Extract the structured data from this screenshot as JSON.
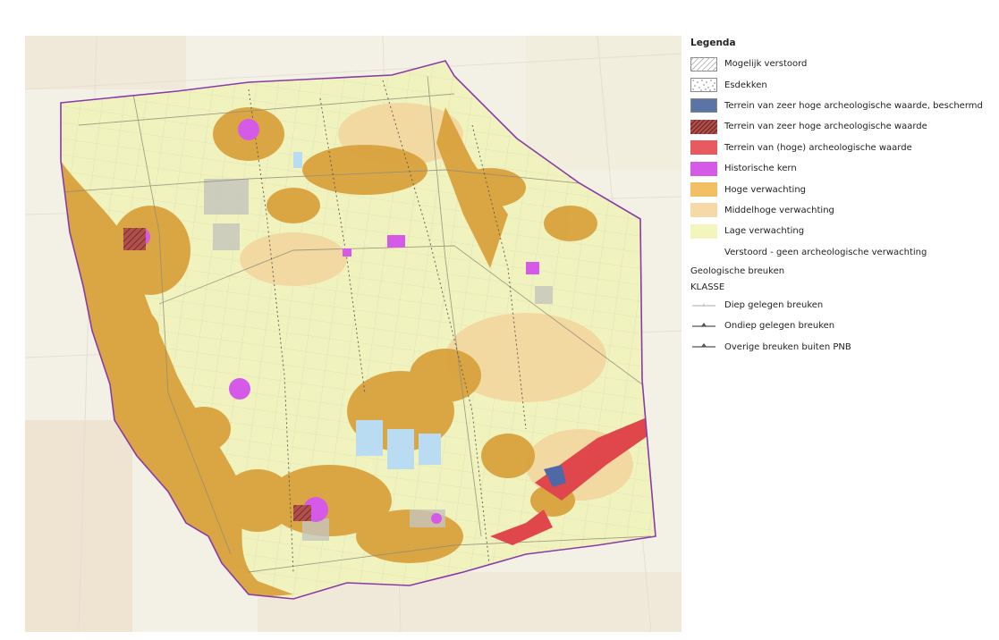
{
  "legend": {
    "title": "Legenda",
    "items": [
      {
        "label": "Mogelijk verstoord",
        "style": "hatch-light",
        "color": "#ffffff"
      },
      {
        "label": "Esdekken",
        "style": "dots",
        "color": "#ffffff"
      },
      {
        "label": "Terrein van zeer hoge archeologische waarde, beschermd",
        "style": "fill",
        "color": "#5a74a8"
      },
      {
        "label": "Terrein van zeer hoge archeologische waarde",
        "style": "hatch-red",
        "color": "#b0504c"
      },
      {
        "label": "Terrein van (hoge) archeologische waarde",
        "style": "fill",
        "color": "#e85a5f"
      },
      {
        "label": "Historische kern",
        "style": "fill",
        "color": "#d55ae8"
      },
      {
        "label": "Hoge verwachting",
        "style": "fill",
        "color": "#f2c062"
      },
      {
        "label": "Middelhoge verwachting",
        "style": "fill",
        "color": "#f5d9a6"
      },
      {
        "label": "Lage verwachting",
        "style": "fill",
        "color": "#f4f5bd"
      },
      {
        "label": "Verstoord - geen archeologische verwachting",
        "style": "none",
        "color": "#ffffff"
      }
    ],
    "group_heading": "Geologische breuken",
    "group_subheading": "KLASSE",
    "line_items": [
      {
        "label": "Diep gelegen breuken",
        "color": "#bbbbbb",
        "marker": false
      },
      {
        "label": "Ondiep gelegen breuken",
        "color": "#555555",
        "marker": true
      },
      {
        "label": "Overige breuken buiten PNB",
        "color": "#555555",
        "marker": true
      }
    ]
  },
  "map": {
    "colors": {
      "hoge": "#d9a23e",
      "middelhoge": "#f2d8a1",
      "lage": "#f1f3bf",
      "historische_kern": "#d55ae8",
      "rood": "#e0474d",
      "beschermd": "#4f68a6",
      "water": "#b9dcf2",
      "boundary": "#8a3aa8",
      "breuken": "#555555",
      "background": "#f3f1e6"
    }
  }
}
